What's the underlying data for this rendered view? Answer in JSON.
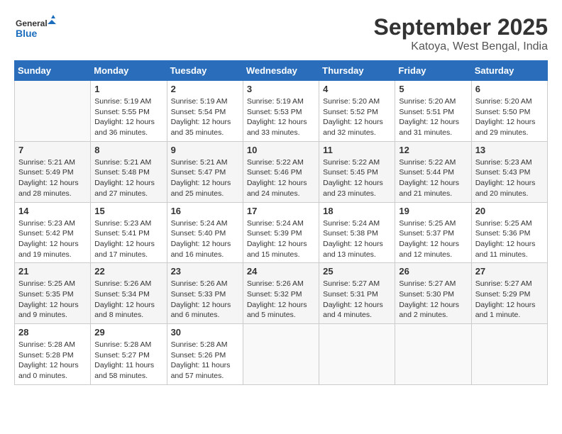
{
  "logo": {
    "text_general": "General",
    "text_blue": "Blue"
  },
  "title": "September 2025",
  "location": "Katoya, West Bengal, India",
  "weekdays": [
    "Sunday",
    "Monday",
    "Tuesday",
    "Wednesday",
    "Thursday",
    "Friday",
    "Saturday"
  ],
  "weeks": [
    [
      {
        "day": "",
        "empty": true
      },
      {
        "day": "1",
        "sunrise": "Sunrise: 5:19 AM",
        "sunset": "Sunset: 5:55 PM",
        "daylight": "Daylight: 12 hours and 36 minutes."
      },
      {
        "day": "2",
        "sunrise": "Sunrise: 5:19 AM",
        "sunset": "Sunset: 5:54 PM",
        "daylight": "Daylight: 12 hours and 35 minutes."
      },
      {
        "day": "3",
        "sunrise": "Sunrise: 5:19 AM",
        "sunset": "Sunset: 5:53 PM",
        "daylight": "Daylight: 12 hours and 33 minutes."
      },
      {
        "day": "4",
        "sunrise": "Sunrise: 5:20 AM",
        "sunset": "Sunset: 5:52 PM",
        "daylight": "Daylight: 12 hours and 32 minutes."
      },
      {
        "day": "5",
        "sunrise": "Sunrise: 5:20 AM",
        "sunset": "Sunset: 5:51 PM",
        "daylight": "Daylight: 12 hours and 31 minutes."
      },
      {
        "day": "6",
        "sunrise": "Sunrise: 5:20 AM",
        "sunset": "Sunset: 5:50 PM",
        "daylight": "Daylight: 12 hours and 29 minutes."
      }
    ],
    [
      {
        "day": "7",
        "sunrise": "Sunrise: 5:21 AM",
        "sunset": "Sunset: 5:49 PM",
        "daylight": "Daylight: 12 hours and 28 minutes."
      },
      {
        "day": "8",
        "sunrise": "Sunrise: 5:21 AM",
        "sunset": "Sunset: 5:48 PM",
        "daylight": "Daylight: 12 hours and 27 minutes."
      },
      {
        "day": "9",
        "sunrise": "Sunrise: 5:21 AM",
        "sunset": "Sunset: 5:47 PM",
        "daylight": "Daylight: 12 hours and 25 minutes."
      },
      {
        "day": "10",
        "sunrise": "Sunrise: 5:22 AM",
        "sunset": "Sunset: 5:46 PM",
        "daylight": "Daylight: 12 hours and 24 minutes."
      },
      {
        "day": "11",
        "sunrise": "Sunrise: 5:22 AM",
        "sunset": "Sunset: 5:45 PM",
        "daylight": "Daylight: 12 hours and 23 minutes."
      },
      {
        "day": "12",
        "sunrise": "Sunrise: 5:22 AM",
        "sunset": "Sunset: 5:44 PM",
        "daylight": "Daylight: 12 hours and 21 minutes."
      },
      {
        "day": "13",
        "sunrise": "Sunrise: 5:23 AM",
        "sunset": "Sunset: 5:43 PM",
        "daylight": "Daylight: 12 hours and 20 minutes."
      }
    ],
    [
      {
        "day": "14",
        "sunrise": "Sunrise: 5:23 AM",
        "sunset": "Sunset: 5:42 PM",
        "daylight": "Daylight: 12 hours and 19 minutes."
      },
      {
        "day": "15",
        "sunrise": "Sunrise: 5:23 AM",
        "sunset": "Sunset: 5:41 PM",
        "daylight": "Daylight: 12 hours and 17 minutes."
      },
      {
        "day": "16",
        "sunrise": "Sunrise: 5:24 AM",
        "sunset": "Sunset: 5:40 PM",
        "daylight": "Daylight: 12 hours and 16 minutes."
      },
      {
        "day": "17",
        "sunrise": "Sunrise: 5:24 AM",
        "sunset": "Sunset: 5:39 PM",
        "daylight": "Daylight: 12 hours and 15 minutes."
      },
      {
        "day": "18",
        "sunrise": "Sunrise: 5:24 AM",
        "sunset": "Sunset: 5:38 PM",
        "daylight": "Daylight: 12 hours and 13 minutes."
      },
      {
        "day": "19",
        "sunrise": "Sunrise: 5:25 AM",
        "sunset": "Sunset: 5:37 PM",
        "daylight": "Daylight: 12 hours and 12 minutes."
      },
      {
        "day": "20",
        "sunrise": "Sunrise: 5:25 AM",
        "sunset": "Sunset: 5:36 PM",
        "daylight": "Daylight: 12 hours and 11 minutes."
      }
    ],
    [
      {
        "day": "21",
        "sunrise": "Sunrise: 5:25 AM",
        "sunset": "Sunset: 5:35 PM",
        "daylight": "Daylight: 12 hours and 9 minutes."
      },
      {
        "day": "22",
        "sunrise": "Sunrise: 5:26 AM",
        "sunset": "Sunset: 5:34 PM",
        "daylight": "Daylight: 12 hours and 8 minutes."
      },
      {
        "day": "23",
        "sunrise": "Sunrise: 5:26 AM",
        "sunset": "Sunset: 5:33 PM",
        "daylight": "Daylight: 12 hours and 6 minutes."
      },
      {
        "day": "24",
        "sunrise": "Sunrise: 5:26 AM",
        "sunset": "Sunset: 5:32 PM",
        "daylight": "Daylight: 12 hours and 5 minutes."
      },
      {
        "day": "25",
        "sunrise": "Sunrise: 5:27 AM",
        "sunset": "Sunset: 5:31 PM",
        "daylight": "Daylight: 12 hours and 4 minutes."
      },
      {
        "day": "26",
        "sunrise": "Sunrise: 5:27 AM",
        "sunset": "Sunset: 5:30 PM",
        "daylight": "Daylight: 12 hours and 2 minutes."
      },
      {
        "day": "27",
        "sunrise": "Sunrise: 5:27 AM",
        "sunset": "Sunset: 5:29 PM",
        "daylight": "Daylight: 12 hours and 1 minute."
      }
    ],
    [
      {
        "day": "28",
        "sunrise": "Sunrise: 5:28 AM",
        "sunset": "Sunset: 5:28 PM",
        "daylight": "Daylight: 12 hours and 0 minutes."
      },
      {
        "day": "29",
        "sunrise": "Sunrise: 5:28 AM",
        "sunset": "Sunset: 5:27 PM",
        "daylight": "Daylight: 11 hours and 58 minutes."
      },
      {
        "day": "30",
        "sunrise": "Sunrise: 5:28 AM",
        "sunset": "Sunset: 5:26 PM",
        "daylight": "Daylight: 11 hours and 57 minutes."
      },
      {
        "day": "",
        "empty": true
      },
      {
        "day": "",
        "empty": true
      },
      {
        "day": "",
        "empty": true
      },
      {
        "day": "",
        "empty": true
      }
    ]
  ]
}
